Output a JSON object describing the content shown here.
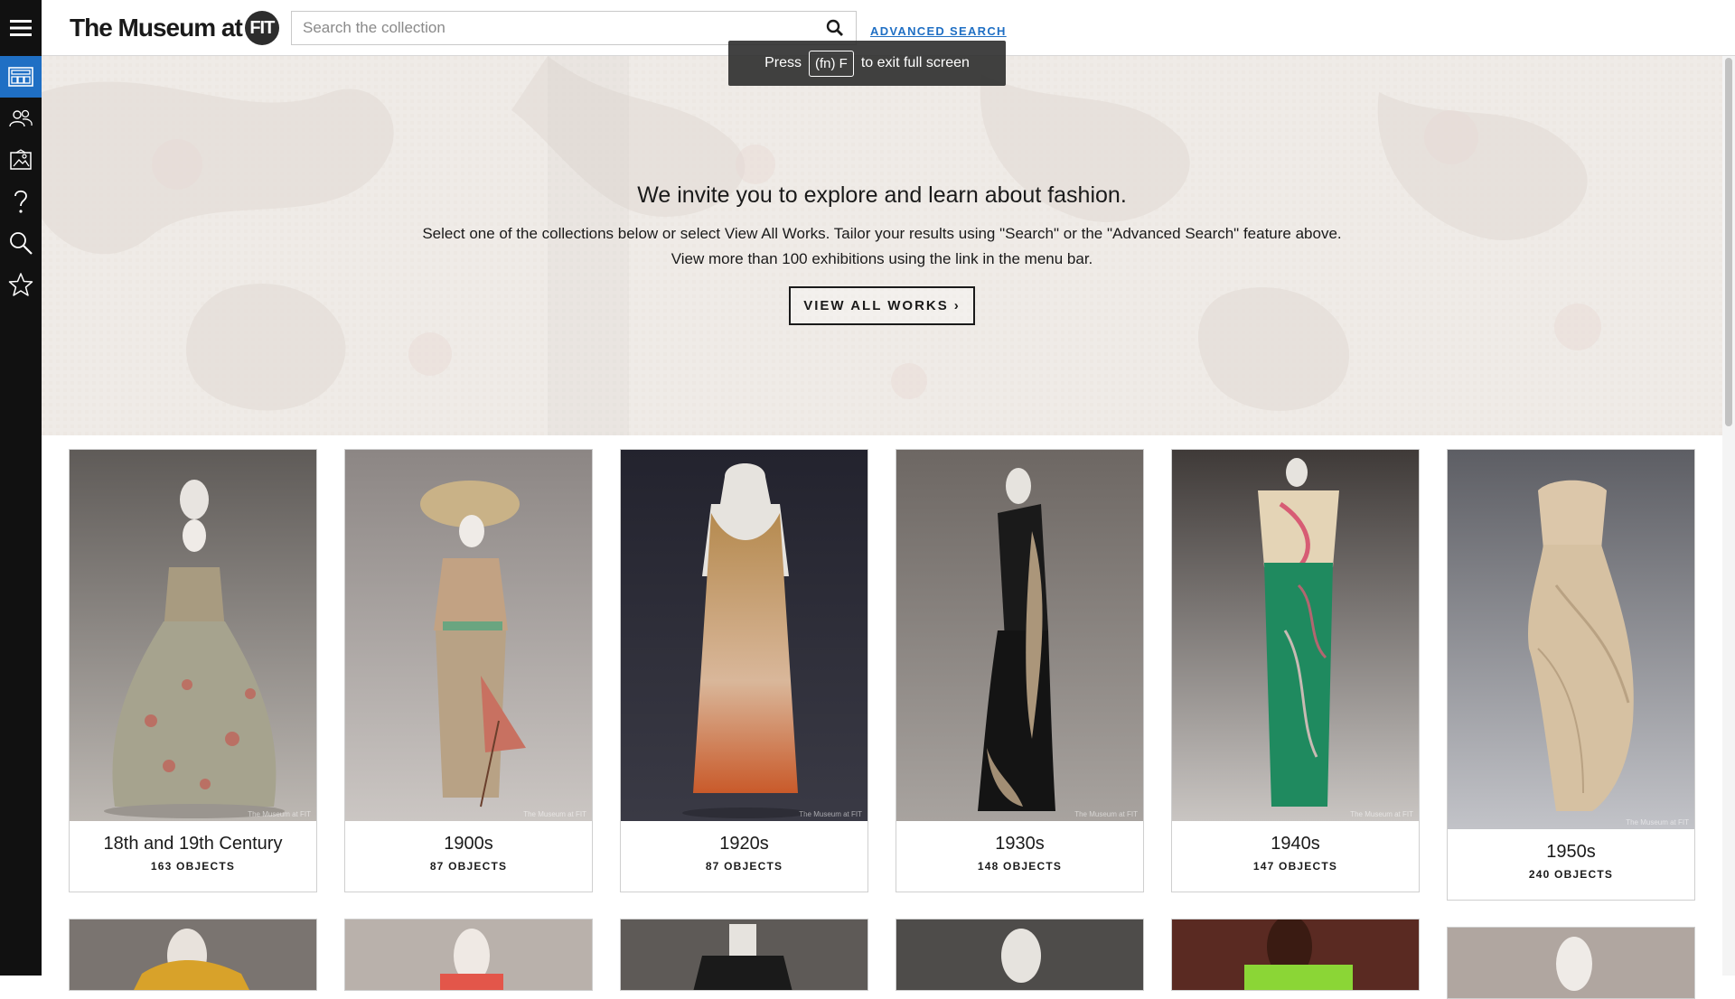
{
  "header": {
    "logo_text": "The Museum at",
    "logo_badge": "FIT",
    "search_placeholder": "Search the collection",
    "advanced_search_label": "ADVANCED SEARCH"
  },
  "toast": {
    "press": "Press",
    "key": "(fn) F",
    "rest": "to exit full screen"
  },
  "sidebar": {
    "items": [
      {
        "icon": "collections-icon"
      },
      {
        "icon": "people-icon"
      },
      {
        "icon": "exhibitions-icon"
      },
      {
        "icon": "help-icon"
      },
      {
        "icon": "search-icon"
      },
      {
        "icon": "favorites-star-icon"
      }
    ]
  },
  "hero": {
    "title": "We invite you to explore and learn about fashion.",
    "line1": "Select one of the collections below or select View All Works. Tailor your results using \"Search\" or the \"Advanced Search\" feature above.",
    "line2": "View more than 100 exhibitions using the link in the menu bar.",
    "button_label": "VIEW ALL WORKS",
    "button_chevron": "›"
  },
  "collections": [
    {
      "title": "18th and 19th Century",
      "count": "163 OBJECTS"
    },
    {
      "title": "1900s",
      "count": "87 OBJECTS"
    },
    {
      "title": "1920s",
      "count": "87 OBJECTS"
    },
    {
      "title": "1930s",
      "count": "148 OBJECTS"
    },
    {
      "title": "1940s",
      "count": "147 OBJECTS"
    },
    {
      "title": "1950s",
      "count": "240 OBJECTS"
    }
  ],
  "watermark": "The Museum at FIT",
  "colors": {
    "accent": "#1f6fc4",
    "rail": "#111111"
  }
}
